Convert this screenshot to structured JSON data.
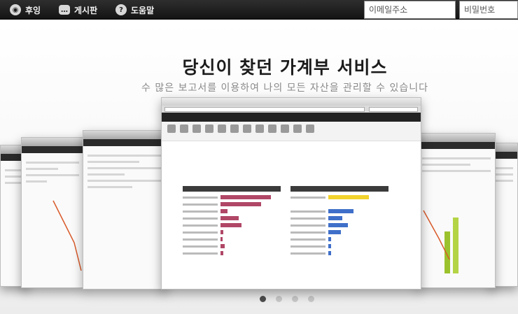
{
  "nav": {
    "items": [
      {
        "label": "후잉",
        "icon": "logo-icon"
      },
      {
        "label": "게시판",
        "icon": "chat-bubble-icon"
      },
      {
        "label": "도움말",
        "icon": "question-icon"
      }
    ],
    "email_placeholder": "이메일주소",
    "password_placeholder": "비밀번호"
  },
  "hero": {
    "title": "당신이 찾던 가계부 서비스",
    "subtitle": "수 많은 보고서를 이용하여 나의 모든 자산을 관리할 수 있습니다"
  },
  "carousel": {
    "slide_count": 4,
    "active_index": 0
  },
  "colors": {
    "topbar": "#1d1d1d",
    "active_dot": "#4d4d4d",
    "inactive_dot": "#c9c9c9",
    "asset_bar": "#b04767",
    "liability_bar": "#3f6fc9",
    "highlight_bar": "#f2d22c"
  }
}
